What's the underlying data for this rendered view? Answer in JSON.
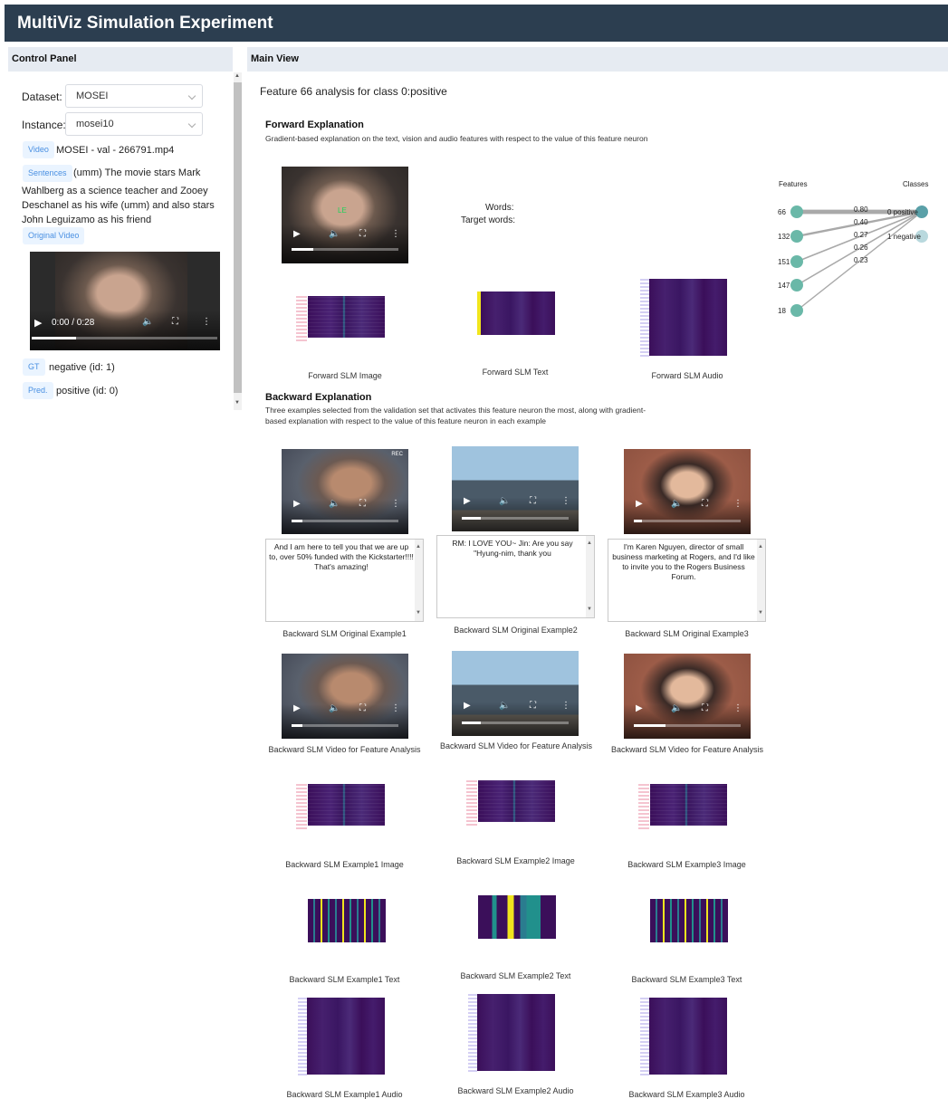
{
  "app": {
    "title": "MultiViz Simulation Experiment"
  },
  "control_panel": {
    "title": "Control Panel",
    "dataset_label": "Dataset:",
    "dataset_value": "MOSEI",
    "instance_label": "Instance:",
    "instance_value": "mosei10",
    "video_tag": "Video",
    "video_text": "MOSEI - val - 266791.mp4",
    "sentences_tag": "Sentences",
    "sentences_first": "(umm) The movie stars Mark",
    "sentences_rest": "Wahlberg as a science teacher and Zooey Deschanel as his wife (umm) and also stars John Leguizamo as his friend",
    "original_video_tag": "Original Video",
    "video_time": "0:00 / 0:28",
    "video_progress": 0.24,
    "gt_tag": "GT",
    "gt_value": "negative (id: 1)",
    "pred_tag": "Pred.",
    "pred_value": "positive (id: 0)"
  },
  "main": {
    "title": "Main View",
    "heading": "Feature 66 analysis for class 0:positive",
    "forward": {
      "title": "Forward Explanation",
      "desc": "Gradient-based explanation on the text, vision and audio features with respect to the value of this feature neuron",
      "words_label": "Words:",
      "target_words_label": "Target words:",
      "video_face_tag": "LE",
      "captions": [
        "Forward SLM Image",
        "Forward SLM Text",
        "Forward SLM Audio"
      ]
    },
    "graph": {
      "features_label": "Features",
      "classes_label": "Classes",
      "features": [
        "66",
        "132",
        "151",
        "147",
        "18"
      ],
      "weights": [
        "0.80",
        "0.40",
        "0.27",
        "0.26",
        "0.23"
      ],
      "classes": [
        "0 positive",
        "1 negative"
      ],
      "colors": {
        "feature": "#6ab8a8",
        "class_active": "#5aa0a8",
        "class_inactive": "#b9d9de",
        "edge": "#a9a9a9"
      }
    },
    "backward": {
      "title": "Backward Explanation",
      "desc_line1": "Three examples selected from the validation set that activates this feature neuron the most, along with gradient-",
      "desc_line2": "based explanation with respect to the value of this feature neuron in each example",
      "texts": [
        "And I am here to tell you that we are up to, over 50% funded with the Kickstarter!!!! That's amazing!",
        "RM: I LOVE YOU~ Jin: Are you say \"Hyung-nim, thank you",
        "I'm Karen Nguyen, director of small business marketing at Rogers, and I'd like to invite you to the Rogers Business Forum."
      ],
      "original_captions": [
        "Backward SLM Original Example1",
        "Backward SLM Original Example2",
        "Backward SLM Original Example3"
      ],
      "video_captions": [
        "Backward SLM Video for Feature Analysis",
        "Backward SLM Video for Feature Analysis",
        "Backward SLM Video for Feature Analysis"
      ],
      "image_captions": [
        "Backward SLM Example1 Image",
        "Backward SLM Example2 Image",
        "Backward SLM Example3 Image"
      ],
      "text_captions": [
        "Backward SLM Example1 Text",
        "Backward SLM Example2 Text",
        "Backward SLM Example3 Text"
      ],
      "audio_captions": [
        "Backward SLM Example1 Audio",
        "Backward SLM Example2 Audio",
        "Backward SLM Example3 Audio"
      ],
      "video1_badge": "REC"
    }
  }
}
